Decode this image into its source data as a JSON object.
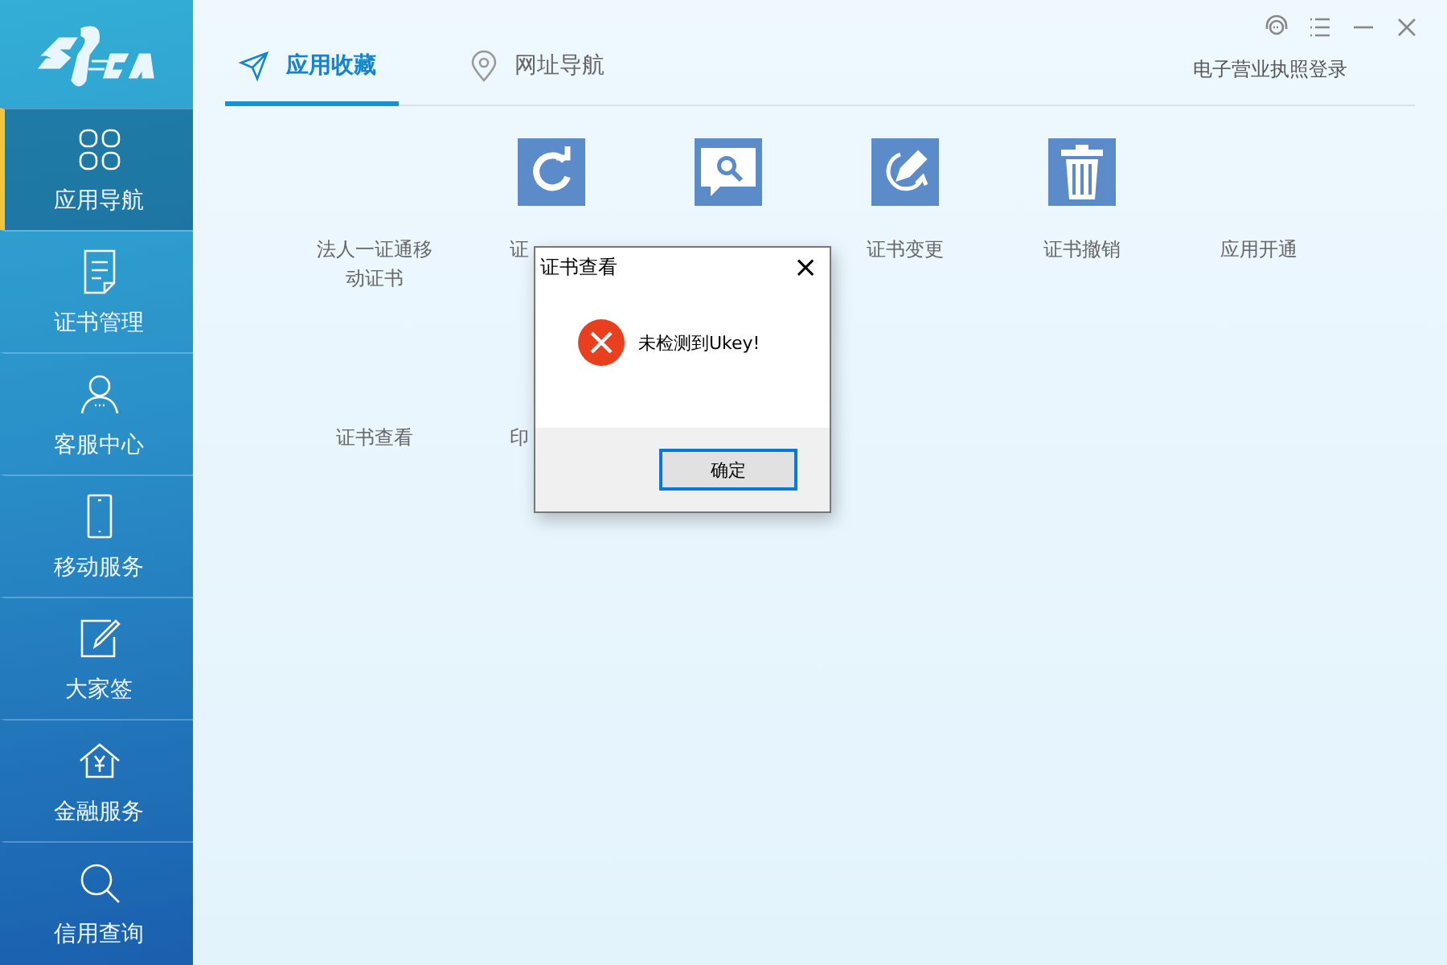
{
  "sidebar": {
    "items": [
      {
        "label": "应用导航",
        "selected": true
      },
      {
        "label": "证书管理",
        "selected": false
      },
      {
        "label": "客服中心",
        "selected": false
      },
      {
        "label": "移动服务",
        "selected": false
      },
      {
        "label": "大家签",
        "selected": false
      },
      {
        "label": "金融服务",
        "selected": false
      },
      {
        "label": "信用查询",
        "selected": false
      }
    ]
  },
  "tabs": [
    {
      "label": "应用收藏",
      "selected": true
    },
    {
      "label": "网址导航",
      "selected": false
    }
  ],
  "login_link": "电子营业执照登录",
  "apps": [
    {
      "kind": "text",
      "label": "法人一证通移动证书"
    },
    {
      "kind": "icon",
      "label": "证"
    },
    {
      "kind": "icon"
    },
    {
      "kind": "icon",
      "label": "证书变更"
    },
    {
      "kind": "icon",
      "label": "证书撤销"
    },
    {
      "kind": "text",
      "label": "应用开通"
    },
    {
      "kind": "text",
      "label": "证书查看"
    },
    {
      "kind": "text",
      "label": "印"
    }
  ],
  "dialog": {
    "title": "证书查看",
    "close": "×",
    "message": "未检测到Ukey!",
    "button": "确定"
  }
}
